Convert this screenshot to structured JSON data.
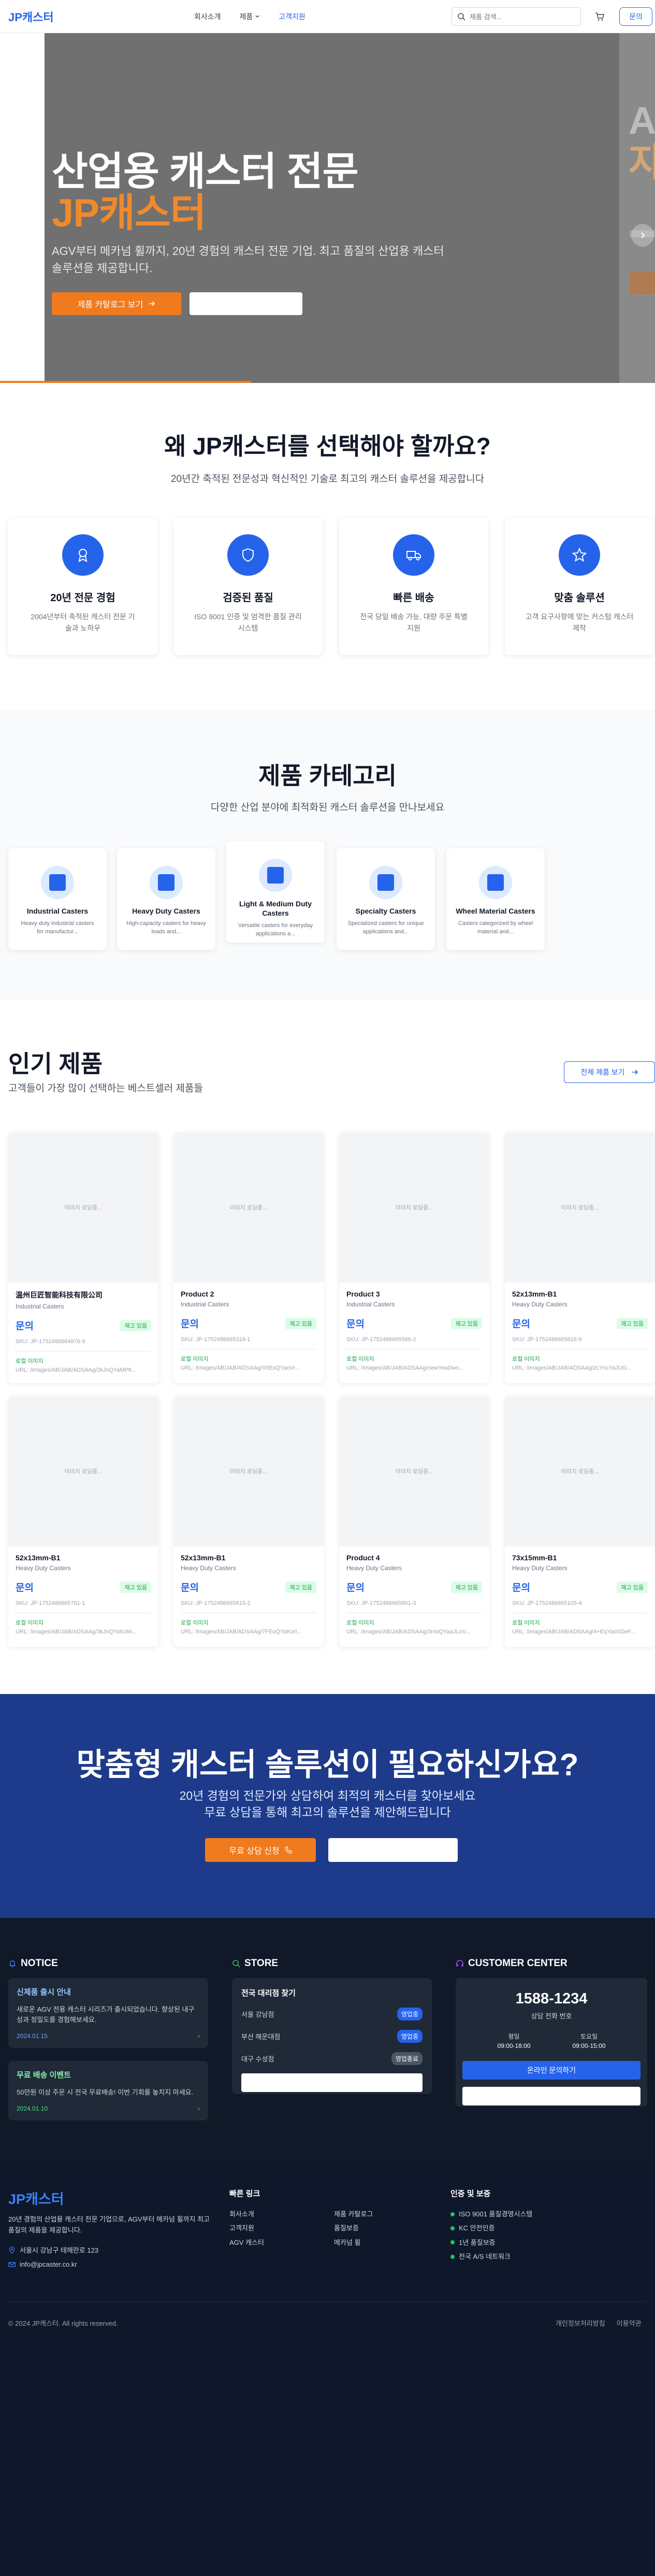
{
  "header": {
    "logo": "JP캐스터",
    "nav": [
      "회사소개",
      "제품",
      "고객지원"
    ],
    "search_placeholder": "제품 검색...",
    "contact": "문의"
  },
  "hero": {
    "title_line1": "산업용 캐스터 전문",
    "title_line2": "JP캐스터",
    "desc": "AGV부터 메카넘 휠까지, 20년 경험의 캐스터 전문 기업. 최고 품질의 산업용 캐스터 솔루션을 제공합니다.",
    "cta": "제품 카탈로그 보기",
    "next_ghost1": "A",
    "next_ghost2": "자",
    "active_slide": 2,
    "slide_count": 5
  },
  "why": {
    "title": "왜 JP캐스터를 선택해야 할까요?",
    "subtitle": "20년간 축적된 전문성과 혁신적인 기술로 최고의 캐스터 솔루션을 제공합니다",
    "cards": [
      {
        "title": "20년 전문 경험",
        "desc": "2004년부터 축적된 캐스터 전문 기술과 노하우"
      },
      {
        "title": "검증된 품질",
        "desc": "ISO 9001 인증 및 엄격한 품질 관리 시스템"
      },
      {
        "title": "빠른 배송",
        "desc": "전국 당일 배송 가능, 대량 주문 특별 지원"
      },
      {
        "title": "맞춤 솔루션",
        "desc": "고객 요구사항에 맞는 커스텀 캐스터 제작"
      }
    ]
  },
  "categories": {
    "title": "제품 카테고리",
    "subtitle": "다양한 산업 분야에 최적화된 캐스터 솔루션을 만나보세요",
    "items": [
      {
        "title": "Industrial Casters",
        "desc": "Heavy-duty industrial casters for manufactur..."
      },
      {
        "title": "Heavy Duty Casters",
        "desc": "High-capacity casters for heavy loads and..."
      },
      {
        "title": "Light & Medium Duty Casters",
        "desc": "Versatile casters for everyday applications a..."
      },
      {
        "title": "Specialty Casters",
        "desc": "Specialized casters for unique applications and..."
      },
      {
        "title": "Wheel Material Casters",
        "desc": "Casters categorized by wheel material and..."
      }
    ]
  },
  "products": {
    "title": "인기 제품",
    "subtitle": "고객들이 가장 많이 선택하는 베스트셀러 제품들",
    "view_all": "전체 제품 보기",
    "image_loading": "이미지 로딩중...",
    "price_label": "문의",
    "stock_label": "재고 있음",
    "image_status": "로컬 이미지",
    "items": [
      {
        "name": "温州巨匠智能科技有限公司",
        "category": "Industrial Casters",
        "sku": "SKU: JP-1752486664976-9",
        "url": "URL: /images/AB/JAB/ADSAAg/2kJnQYaMPK..."
      },
      {
        "name": "Product 2",
        "category": "Industrial Casters",
        "sku": "SKU: JP-1752486665316-1",
        "url": "URL: /images/AB/JAB/ADSAAg/XhEsQYaoVr..."
      },
      {
        "name": "Product 3",
        "category": "Industrial Casters",
        "sku": "SKU: JP-1752486665566-2",
        "url": "URL: /images/AB/JAB/ADSAAg/newYeaDwx..."
      },
      {
        "name": "52x13mm-B1",
        "category": "Heavy Duty Casters",
        "sku": "SKU: JP-1752486665818-9",
        "url": "URL: /images/AB/JAB/ADSAAg/zLYncYaJUG..."
      },
      {
        "name": "52x13mm-B1",
        "category": "Heavy Duty Casters",
        "sku": "SKU: JP-1752486665781-1",
        "url": "URL: /images/AB/JAB/ADSAAg/3kJnQYaKoM..."
      },
      {
        "name": "52x13mm-B1",
        "category": "Heavy Duty Casters",
        "sku": "SKU: JP-1752486665815-2",
        "url": "URL: /images/AB/JAB/ADSAAg/7FEoQYaKorl..."
      },
      {
        "name": "Product 4",
        "category": "Heavy Duty Casters",
        "sku": "SKU: JP-1752486665801-3",
        "url": "URL: /images/AB/JAB/ADSAAg/3nIoQYaaJLoV..."
      },
      {
        "name": "73x15mm-B1",
        "category": "Heavy Duty Casters",
        "sku": "SKU: JP-1752486665105-4",
        "url": "URL: /images/AB/JAB/ADSAAg/4+EqYaoSDeF..."
      }
    ]
  },
  "cta": {
    "title": "맞춤형 캐스터 솔루션이 필요하신가요?",
    "line1": "20년 경험의 전문가와 상담하여 최적의 캐스터를 찾아보세요",
    "line2": "무료 상담을 통해 최고의 솔루션을 제안해드립니다",
    "button": "무료 상담 신청"
  },
  "info": {
    "notice_heading": "NOTICE",
    "notices": [
      {
        "title": "신제품 출시 안내",
        "desc": "새로운 AGV 전용 캐스터 시리즈가 출시되었습니다. 향상된 내구성과 정밀도를 경험해보세요.",
        "date": "2024.01.15"
      },
      {
        "title": "무료 배송 이벤트",
        "desc": "50만원 이상 주문 시 전국 무료배송! 이번 기회를 놓치지 마세요.",
        "date": "2024.01.10"
      }
    ],
    "store_heading": "STORE",
    "store_title": "전국 대리점 찾기",
    "stores": [
      {
        "name": "서울 강남점",
        "status": "영업중"
      },
      {
        "name": "부산 해운대점",
        "status": "영업중"
      },
      {
        "name": "대구 수성점",
        "status": "영업종료"
      }
    ],
    "center_heading": "CUSTOMER CENTER",
    "phone": "1588-1234",
    "phone_label": "상담 전화 번호",
    "weekday_label": "평일",
    "weekday_hours": "09:00-18:00",
    "saturday_label": "토요일",
    "saturday_hours": "09:00-15:00",
    "online_inquiry": "온라인 문의하기"
  },
  "footer": {
    "logo": "JP캐스터",
    "desc": "20년 경험의 산업용 캐스터 전문 기업으로, AGV부터 메카넘 휠까지 최고 품질의 제품을 제공합니다.",
    "address": "서울시 강남구 테헤란로 123",
    "email": "info@jpcaster.co.kr",
    "quick_links_heading": "빠른 링크",
    "links_col1": [
      "회사소개",
      "고객지원",
      "AGV 캐스터"
    ],
    "links_col2": [
      "제품 카탈로그",
      "품질보증",
      "메카넘 휠"
    ],
    "cert_heading": "인증 및 보증",
    "certs": [
      "ISO 9001 품질경영시스템",
      "KC 안전인증",
      "1년 품질보증",
      "전국 A/S 네트워크"
    ],
    "copyright": "© 2024 JP캐스터. All rights reserved.",
    "privacy": "개인정보처리방침",
    "terms": "이용약관"
  },
  "colors": {
    "primary": "#2563eb",
    "accent": "#f07a1e",
    "dark": "#111827",
    "cta_bg": "#1e3a8a"
  }
}
